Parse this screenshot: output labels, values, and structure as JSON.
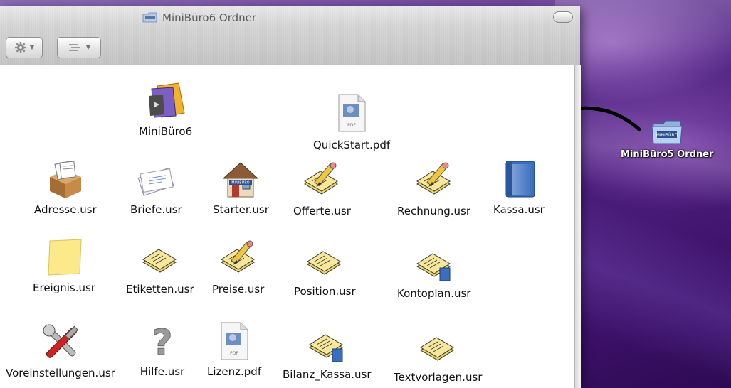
{
  "window": {
    "title": "MiniBüro6 Ordner"
  },
  "toolbar": {
    "action_button": "gear-icon",
    "view_button": "list-view-icon"
  },
  "items": [
    {
      "label": "MiniBüro6",
      "icon": "folder-app-icon"
    },
    {
      "label": "QuickStart.pdf",
      "icon": "pdf-file-icon",
      "badge": "PDF"
    },
    {
      "label": "Adresse.usr",
      "icon": "address-box-icon"
    },
    {
      "label": "Briefe.usr",
      "icon": "letter-envelope-icon"
    },
    {
      "label": "Starter.usr",
      "icon": "house-icon",
      "badge": "MINIBÜRO"
    },
    {
      "label": "Offerte.usr",
      "icon": "document-pencil-icon"
    },
    {
      "label": "Rechnung.usr",
      "icon": "document-pencil-icon"
    },
    {
      "label": "Kassa.usr",
      "icon": "blue-book-icon"
    },
    {
      "label": "Ereignis.usr",
      "icon": "sticky-note-icon"
    },
    {
      "label": "Etiketten.usr",
      "icon": "document-stack-icon"
    },
    {
      "label": "Preise.usr",
      "icon": "document-pencil-icon"
    },
    {
      "label": "Position.usr",
      "icon": "document-stack-icon"
    },
    {
      "label": "Kontoplan.usr",
      "icon": "document-stack-book-icon"
    },
    {
      "label": "Voreinstellungen.usr",
      "icon": "tools-icon"
    },
    {
      "label": "Hilfe.usr",
      "icon": "question-mark-icon"
    },
    {
      "label": "Lizenz.pdf",
      "icon": "pdf-file-icon",
      "badge": "PDF"
    },
    {
      "label": "Bilanz_Kassa.usr",
      "icon": "document-stack-book-icon"
    },
    {
      "label": "Textvorlagen.usr",
      "icon": "document-stack-icon"
    }
  ],
  "desktop": {
    "folder_label": "MiniBüro5 Ordner",
    "folder_badge": "MINIBÜRO",
    "folder_icon": "folder-icon"
  },
  "colors": {
    "desktop_purple": "#4d1f7e",
    "book_blue": "#3a6fc0",
    "note_yellow": "#fbe98a"
  }
}
